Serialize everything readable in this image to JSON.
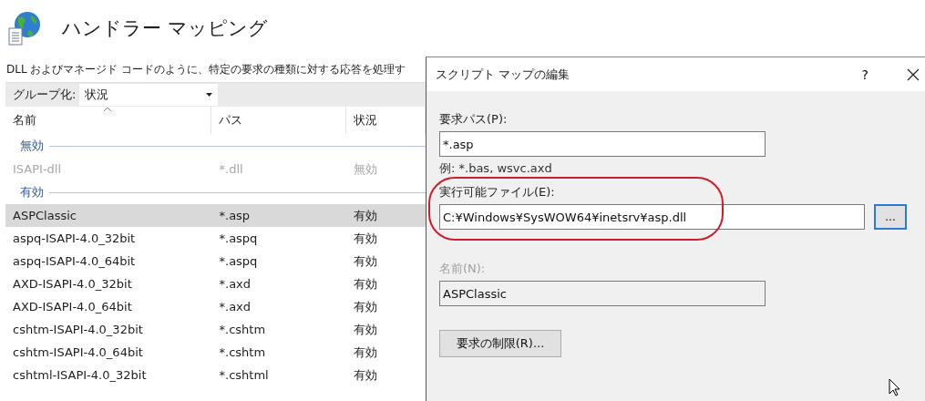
{
  "page": {
    "title": "ハンドラー マッピング",
    "description": "DLL およびマネージド コードのように、特定の要求の種類に対する応答を処理す"
  },
  "toolbar": {
    "group_by_label": "グループ化:",
    "group_by_value": "状況"
  },
  "table": {
    "columns": [
      "名前",
      "パス",
      "状況"
    ],
    "rows": [
      {
        "kind": "group",
        "label": "無効"
      },
      {
        "kind": "item",
        "name": "ISAPI-dll",
        "path": "*.dll",
        "status": "無効",
        "disabled": true,
        "selected": false
      },
      {
        "kind": "group",
        "label": "有効"
      },
      {
        "kind": "item",
        "name": "ASPClassic",
        "path": "*.asp",
        "status": "有効",
        "disabled": false,
        "selected": true
      },
      {
        "kind": "item",
        "name": "aspq-ISAPI-4.0_32bit",
        "path": "*.aspq",
        "status": "有効",
        "disabled": false,
        "selected": false
      },
      {
        "kind": "item",
        "name": "aspq-ISAPI-4.0_64bit",
        "path": "*.aspq",
        "status": "有効",
        "disabled": false,
        "selected": false
      },
      {
        "kind": "item",
        "name": "AXD-ISAPI-4.0_32bit",
        "path": "*.axd",
        "status": "有効",
        "disabled": false,
        "selected": false
      },
      {
        "kind": "item",
        "name": "AXD-ISAPI-4.0_64bit",
        "path": "*.axd",
        "status": "有効",
        "disabled": false,
        "selected": false
      },
      {
        "kind": "item",
        "name": "cshtm-ISAPI-4.0_32bit",
        "path": "*.cshtm",
        "status": "有効",
        "disabled": false,
        "selected": false
      },
      {
        "kind": "item",
        "name": "cshtm-ISAPI-4.0_64bit",
        "path": "*.cshtm",
        "status": "有効",
        "disabled": false,
        "selected": false
      },
      {
        "kind": "item",
        "name": "cshtml-ISAPI-4.0_32bit",
        "path": "*.cshtml",
        "status": "有効",
        "disabled": false,
        "selected": false
      }
    ]
  },
  "dialog": {
    "title": "スクリプト マップの編集",
    "help": "?",
    "request_path": {
      "label": "要求パス(P):",
      "value": "*.asp",
      "hint": "例: *.bas, wsvc.axd"
    },
    "executable": {
      "label": "実行可能ファイル(E):",
      "value": "C:¥Windows¥SysWOW64¥inetsrv¥asp.dll",
      "browse": "..."
    },
    "name": {
      "label": "名前(N):",
      "value": "ASPClassic",
      "disabled": true
    },
    "restrictions_button": "要求の制限(R)..."
  }
}
